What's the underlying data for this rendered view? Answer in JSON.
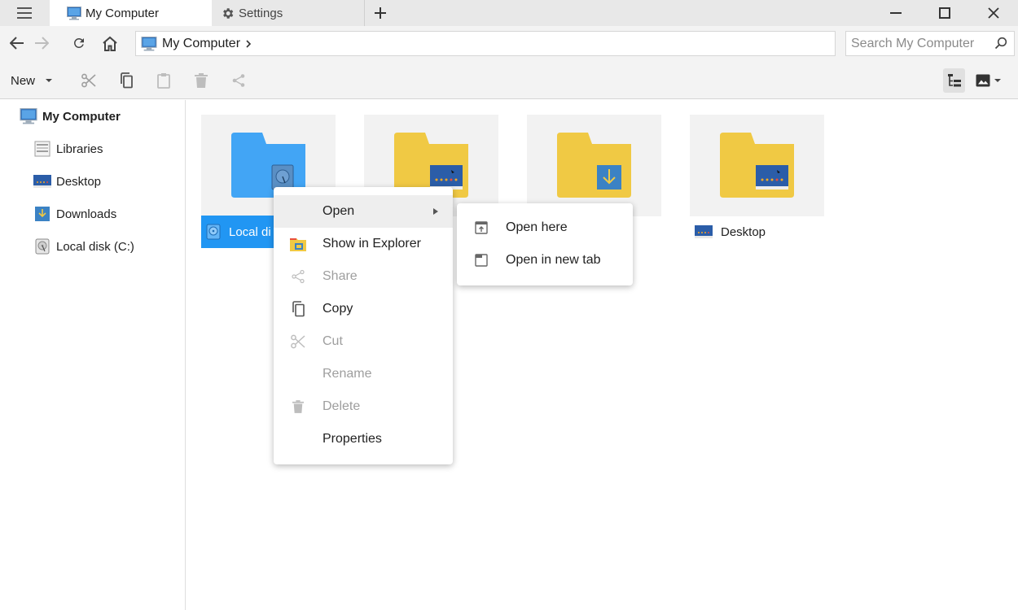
{
  "window": {
    "tabs": [
      {
        "label": "My Computer",
        "icon": "computer-icon",
        "active": true
      },
      {
        "label": "Settings",
        "icon": "gear-icon",
        "active": false
      }
    ],
    "new_tab": "+",
    "controls": [
      "minimize-icon",
      "maximize-icon",
      "close-icon"
    ]
  },
  "nav": {
    "address_label": "My Computer",
    "search_placeholder": "Search My Computer"
  },
  "toolbar": {
    "new_label": "New",
    "actions": [
      "cut-icon",
      "copy-icon",
      "paste-icon",
      "delete-icon",
      "share-icon"
    ]
  },
  "sidebar": {
    "root": "My Computer",
    "items": [
      {
        "label": "Libraries",
        "icon": "library-icon"
      },
      {
        "label": "Desktop",
        "icon": "desktop-icon"
      },
      {
        "label": "Downloads",
        "icon": "downloads-icon"
      },
      {
        "label": "Local disk (C:)",
        "icon": "disk-icon"
      }
    ]
  },
  "content": {
    "tiles": [
      {
        "label": "Local di",
        "selected": true
      },
      {
        "label": "",
        "selected": false
      },
      {
        "label": "",
        "selected": false
      },
      {
        "label": "Desktop",
        "selected": false
      }
    ]
  },
  "context_menu": {
    "items": [
      {
        "label": "Open",
        "icon": "",
        "disabled": false,
        "submenu": true
      },
      {
        "label": "Show in Explorer",
        "icon": "explorer-icon",
        "disabled": false
      },
      {
        "label": "Share",
        "icon": "share-icon",
        "disabled": true
      },
      {
        "label": "Copy",
        "icon": "copy-icon",
        "disabled": false
      },
      {
        "label": "Cut",
        "icon": "cut-icon",
        "disabled": true
      },
      {
        "label": "Rename",
        "icon": "",
        "disabled": true
      },
      {
        "label": "Delete",
        "icon": "delete-icon",
        "disabled": true
      },
      {
        "label": "Properties",
        "icon": "",
        "disabled": false
      }
    ],
    "submenu": [
      {
        "label": "Open here",
        "icon": "open-here-icon"
      },
      {
        "label": "Open in new tab",
        "icon": "new-tab-icon"
      }
    ]
  },
  "colors": {
    "accent": "#2196f3",
    "folder_yellow": "#f0c944",
    "folder_blue": "#42a5f5",
    "disabled_text": "#9e9e9e"
  }
}
